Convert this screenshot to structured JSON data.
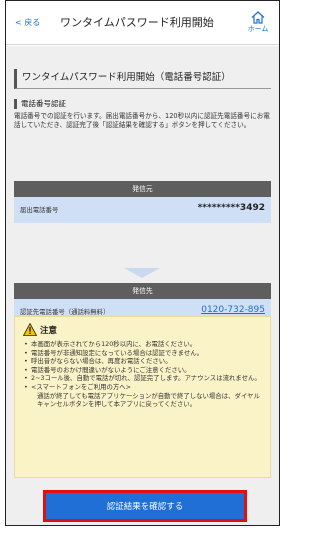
{
  "header": {
    "back_label": "< 戻る",
    "title": "ワンタイムパスワード利用開始",
    "home_label": "ホーム",
    "home_icon": "home-icon"
  },
  "section": {
    "title": "ワンタイムパスワード利用開始（電話番号認証）",
    "subtitle": "電話番号認証",
    "description": "電話番号での認証を行います。届出電話番号から、120秒以内に認証先電話番号にお電話していただき、認証完了後「認証結果を確認する」ボタンを押してください。"
  },
  "source_card": {
    "header": "発信元",
    "label": "届出電話番号",
    "value": "*********3492"
  },
  "dest_card": {
    "header": "発信先",
    "label": "認証先電話番号（通話料無料）",
    "value": "0120-732-895"
  },
  "notice": {
    "icon": "warning-icon",
    "title": "注意",
    "items": [
      "本画面が表示されてから120秒以内に、お電話ください。",
      "電話番号が非通知設定になっている場合は認証できません。",
      "呼出音がならない場合は、再度お電話ください。",
      "電話番号のおかけ間違いがないようにご注意ください。",
      "2~3コール後、自動で電話が切れ、認証完了します。アナウンスは流れません。",
      "<スマートフォンをご利用の方へ>",
      "通話が終了しても電話アプリケーションが自動で終了しない場合は、ダイヤルキャンセルボタンを押して本アプリに戻ってください。"
    ]
  },
  "confirm_button": {
    "label": "認証結果を確認する"
  },
  "colors": {
    "accent": "#1f6fd6",
    "highlight_border": "#e01010",
    "card_bg": "#cfe0f6",
    "card_header": "#5e5e5e",
    "notice_bg": "#fbf3c8"
  }
}
